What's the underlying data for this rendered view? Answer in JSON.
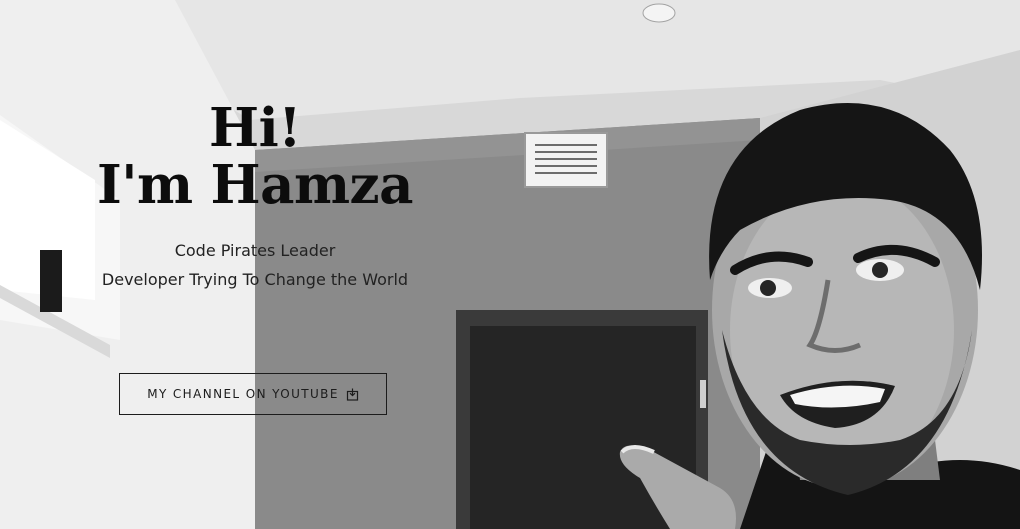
{
  "hero": {
    "headline_line1": "Hi!",
    "headline_line2": "I'm Hamza",
    "tagline_line1": "Code Pirates Leader",
    "tagline_line2": "Developer Trying To Change the World",
    "cta_label": "MY CHANNEL ON YOUTUBE",
    "cta_icon": "external-link-icon"
  }
}
